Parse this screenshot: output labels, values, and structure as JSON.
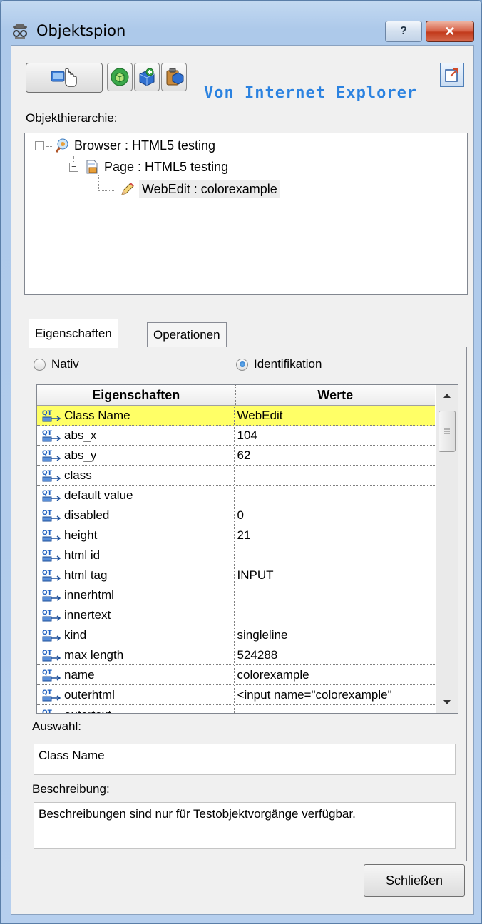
{
  "window": {
    "title": "Objektspion",
    "help_glyph": "?",
    "close_glyph": "✕"
  },
  "toolbar": {
    "source_label": "Von Internet Explorer"
  },
  "hierarchy": {
    "label": "Objekthierarchie:",
    "nodes": [
      {
        "label": "Browser : HTML5 testing",
        "expander": "−"
      },
      {
        "label": "Page : HTML5 testing",
        "expander": "−"
      },
      {
        "label": "WebEdit : colorexample",
        "selected": true
      }
    ]
  },
  "tabs": {
    "properties": "Eigenschaften",
    "operations": "Operationen"
  },
  "mode": {
    "native": "Nativ",
    "identification": "Identifikation",
    "selected": "identification"
  },
  "grid": {
    "headers": {
      "property": "Eigenschaften",
      "value": "Werte"
    },
    "rows": [
      {
        "property": "Class Name",
        "value": "WebEdit"
      },
      {
        "property": "abs_x",
        "value": "104"
      },
      {
        "property": "abs_y",
        "value": "62"
      },
      {
        "property": "class",
        "value": ""
      },
      {
        "property": "default value",
        "value": ""
      },
      {
        "property": "disabled",
        "value": "0"
      },
      {
        "property": "height",
        "value": "21"
      },
      {
        "property": "html id",
        "value": ""
      },
      {
        "property": "html tag",
        "value": "INPUT"
      },
      {
        "property": "innerhtml",
        "value": ""
      },
      {
        "property": "innertext",
        "value": ""
      },
      {
        "property": "kind",
        "value": "singleline"
      },
      {
        "property": "max length",
        "value": "524288"
      },
      {
        "property": "name",
        "value": "colorexample"
      },
      {
        "property": "outerhtml",
        "value": "<input name=\"colorexample\""
      },
      {
        "property": "outertext",
        "value": ""
      }
    ]
  },
  "selection": {
    "label": "Auswahl:",
    "value": "Class Name"
  },
  "description": {
    "label": "Beschreibung:",
    "value": "Beschreibungen sind nur für Testobjektvorgänge verfügbar."
  },
  "buttons": {
    "close_label": "Schließen",
    "close_mnemonic": "c"
  },
  "colors": {
    "highlight_row": "#ffff66",
    "source_text": "#2b82e0",
    "title_close": "#c23a1c"
  }
}
